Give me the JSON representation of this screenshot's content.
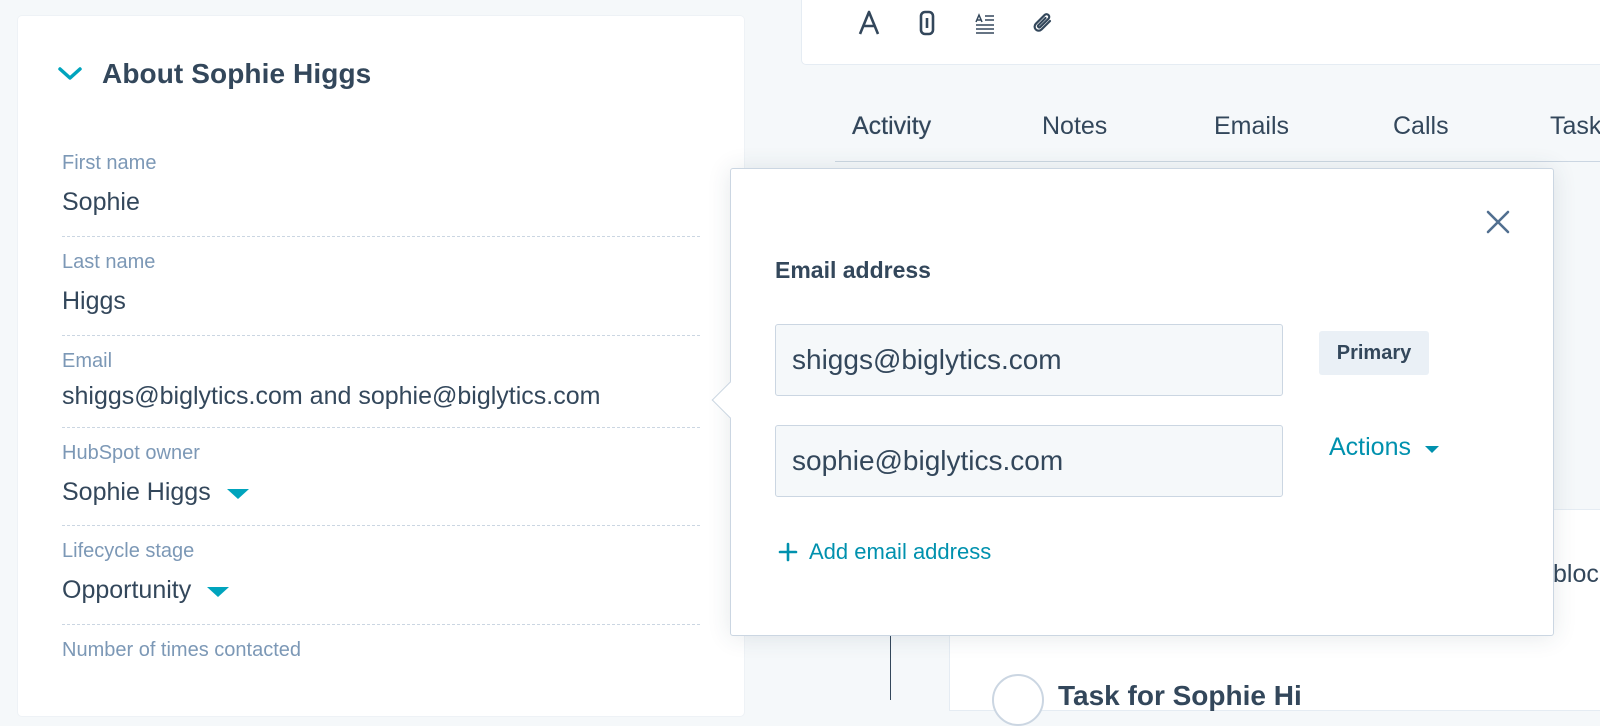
{
  "about": {
    "title": "About Sophie Higgs",
    "fields": [
      {
        "label": "First name",
        "value": "Sophie"
      },
      {
        "label": "Last name",
        "value": "Higgs"
      },
      {
        "label": "Email",
        "value": "shiggs@biglytics.com and sophie@biglytics.com"
      },
      {
        "label": "HubSpot owner",
        "value": "Sophie Higgs"
      },
      {
        "label": "Lifecycle stage",
        "value": "Opportunity"
      },
      {
        "label": "Number of times contacted",
        "value": ""
      }
    ]
  },
  "toolbar": {
    "icons": [
      "font-style-icon",
      "link-icon",
      "text-align-icon",
      "attachment-icon"
    ]
  },
  "tabs": [
    {
      "label": "Activity",
      "active": true
    },
    {
      "label": "Notes"
    },
    {
      "label": "Emails"
    },
    {
      "label": "Calls"
    },
    {
      "label": "Tasks"
    }
  ],
  "timeline": {
    "clipped_text": "bloc",
    "task_title": "Task for Sophie Hi"
  },
  "popover": {
    "heading": "Email address",
    "emails": [
      {
        "value": "shiggs@biglytics.com",
        "badge": "Primary"
      },
      {
        "value": "sophie@biglytics.com",
        "action": "Actions"
      }
    ],
    "add_label": "Add email address"
  },
  "colors": {
    "accent": "#00a4bd",
    "link": "#0091ae",
    "text": "#33475b",
    "label": "#7c98b6",
    "border": "#cbd6e2",
    "background": "#f5f8fa"
  }
}
